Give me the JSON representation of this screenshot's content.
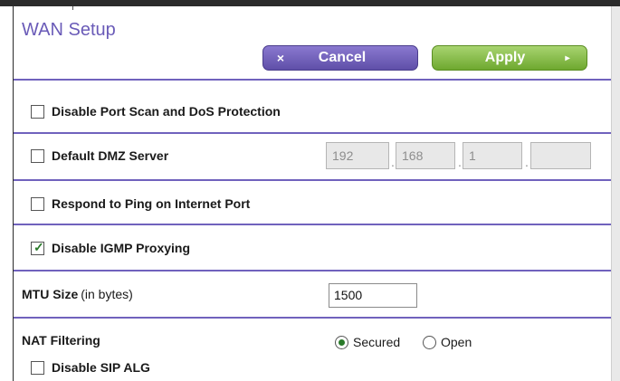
{
  "page": {
    "title": "WAN Setup"
  },
  "toolbar": {
    "cancel_icon": "×",
    "cancel_label": "Cancel",
    "apply_label": "Apply",
    "apply_icon": "▸"
  },
  "settings": {
    "disable_port_scan": {
      "label": "Disable Port Scan and DoS Protection",
      "checked": false
    },
    "default_dmz": {
      "label": "Default DMZ Server",
      "checked": false,
      "ip": [
        "192",
        "168",
        "1",
        ""
      ]
    },
    "respond_ping": {
      "label": "Respond to Ping on Internet Port",
      "checked": false
    },
    "disable_igmp": {
      "label": "Disable IGMP Proxying",
      "checked": true,
      "check_glyph": "✓"
    },
    "mtu": {
      "label": "MTU Size",
      "unit": "(in bytes)",
      "value": "1500"
    },
    "nat_filtering": {
      "label": "NAT Filtering",
      "options": [
        "Secured",
        "Open"
      ],
      "selected": "Secured"
    },
    "disable_sip_alg": {
      "label": "Disable SIP ALG",
      "checked": false
    }
  },
  "colors": {
    "title": "#6a5bb8",
    "divider": "#7062bd",
    "cancel": "#5f4fa8",
    "apply": "#6ea82f"
  }
}
